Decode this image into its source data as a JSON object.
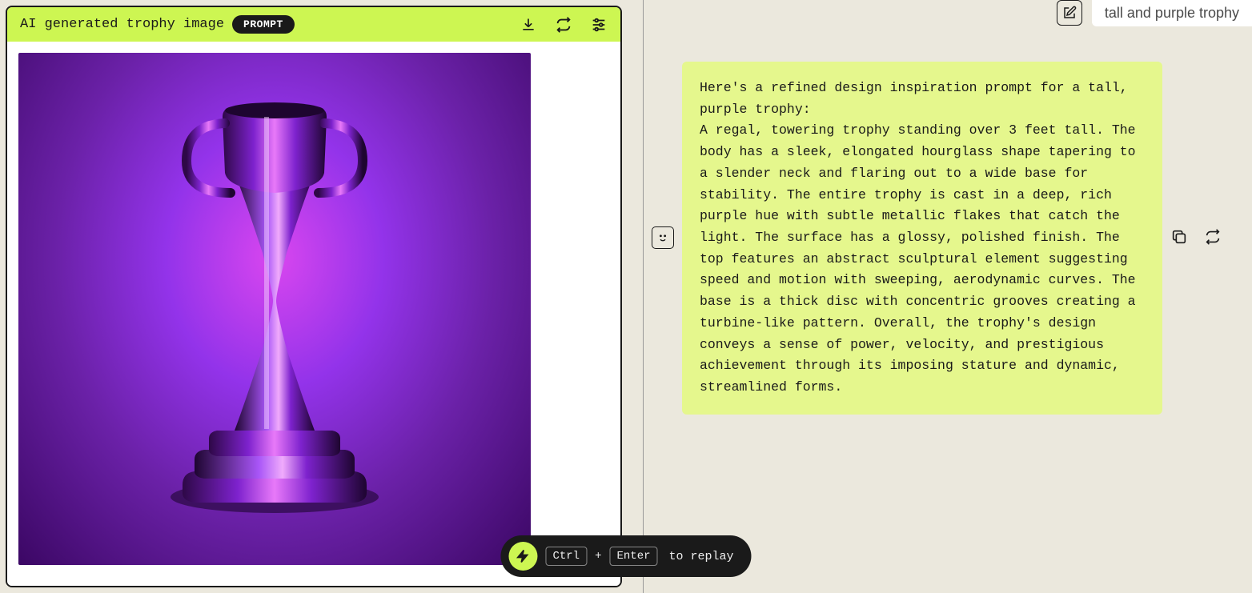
{
  "leftPanel": {
    "title": "AI generated trophy image",
    "badge": "PROMPT"
  },
  "userMessage": "tall and purple trophy",
  "response": "Here's a refined design inspiration prompt for a tall, purple trophy:\nA regal, towering trophy standing over 3 feet tall. The body has a sleek, elongated hourglass shape tapering to a slender neck and flaring out to a wide base for stability. The entire trophy is cast in a deep, rich purple hue with subtle metallic flakes that catch the light. The surface has a glossy, polished finish. The top features an abstract sculptural element suggesting speed and motion with sweeping, aerodynamic curves. The base is a thick disc with concentric grooves creating a turbine-like pattern. Overall, the trophy's design conveys a sense of power, velocity, and prestigious achievement through its imposing stature and dynamic, streamlined forms.",
  "replayBar": {
    "key1": "Ctrl",
    "plus": "+",
    "key2": "Enter",
    "label": "to replay"
  }
}
